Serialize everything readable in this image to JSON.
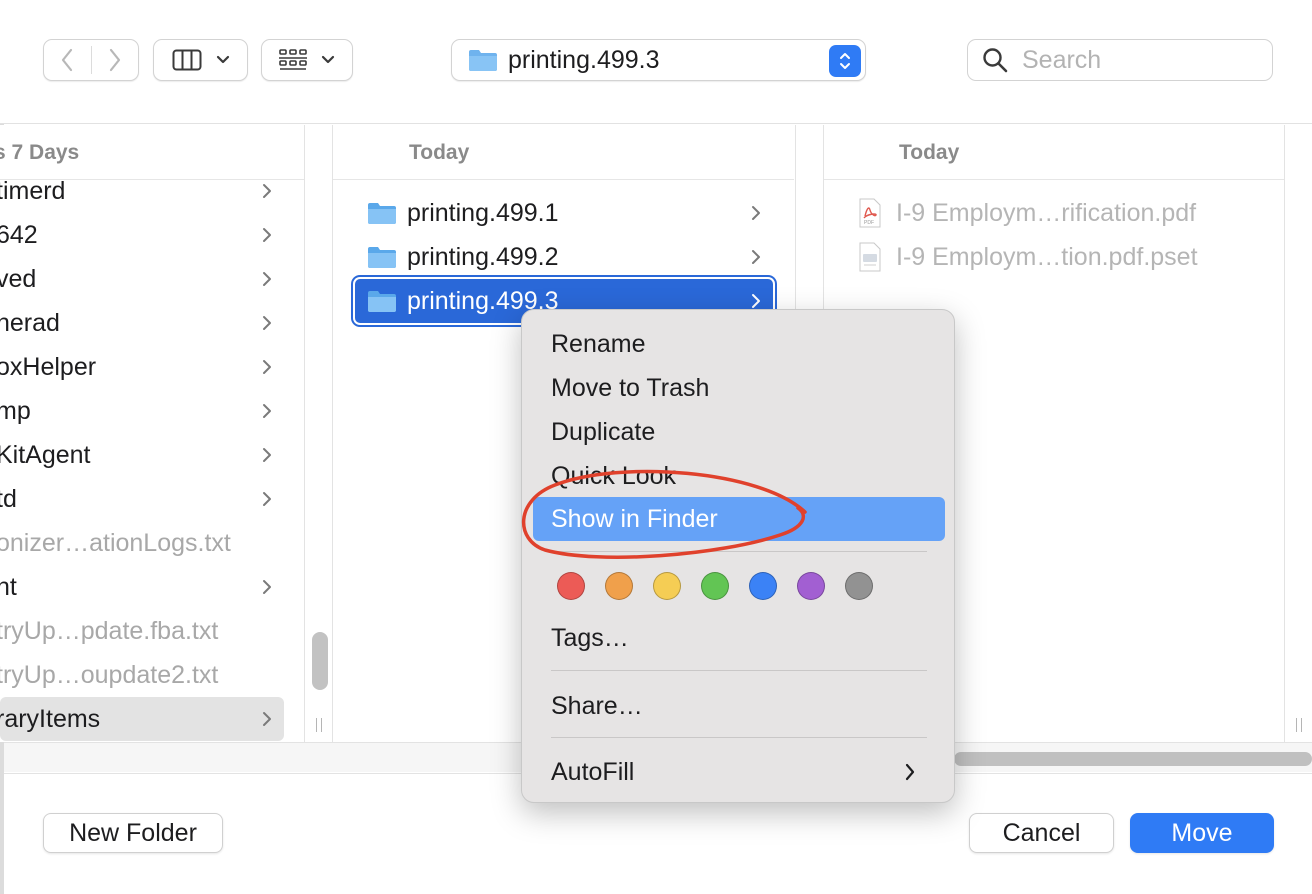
{
  "toolbar": {
    "path_label": "printing.499.3",
    "search_placeholder": "Search"
  },
  "columns": [
    {
      "header": "s 7 Days",
      "items": [
        {
          "label": "timerd",
          "has_children": true,
          "dimmed": false
        },
        {
          "label": "642",
          "has_children": true,
          "dimmed": false
        },
        {
          "label": "ved",
          "has_children": true,
          "dimmed": false
        },
        {
          "label": "nerad",
          "has_children": true,
          "dimmed": false
        },
        {
          "label": "oxHelper",
          "has_children": true,
          "dimmed": false
        },
        {
          "label": "mp",
          "has_children": true,
          "dimmed": false
        },
        {
          "label": "KitAgent",
          "has_children": true,
          "dimmed": false
        },
        {
          "label": "td",
          "has_children": true,
          "dimmed": false
        },
        {
          "label": "onizer…ationLogs.txt",
          "has_children": false,
          "dimmed": true
        },
        {
          "label": "nt",
          "has_children": true,
          "dimmed": false
        },
        {
          "label": "tryUp…pdate.fba.txt",
          "has_children": false,
          "dimmed": true
        },
        {
          "label": "tryUp…oupdate2.txt",
          "has_children": false,
          "dimmed": true
        },
        {
          "label": "raryItems",
          "has_children": true,
          "dimmed": false,
          "selected": true
        }
      ]
    },
    {
      "header": "Today",
      "items": [
        {
          "label": "printing.499.1",
          "icon": "folder-icon"
        },
        {
          "label": "printing.499.2",
          "icon": "folder-icon"
        },
        {
          "label": "printing.499.3",
          "icon": "folder-icon",
          "selected": true
        }
      ]
    },
    {
      "header": "Today",
      "items": [
        {
          "label": "I-9 Employm…rification.pdf",
          "icon": "pdf-file-icon"
        },
        {
          "label": "I-9 Employm…tion.pdf.pset",
          "icon": "document-file-icon"
        }
      ]
    }
  ],
  "context_menu": {
    "items": {
      "rename": "Rename",
      "move_to_trash": "Move to Trash",
      "duplicate": "Duplicate",
      "quick_look": "Quick Look",
      "show_in_finder": "Show in Finder",
      "tags": "Tags…",
      "share": "Share…",
      "autofill": "AutoFill"
    },
    "highlighted": "Show in Finder",
    "tag_colors": [
      "#ec5b56",
      "#f0a04b",
      "#f5cd54",
      "#62c554",
      "#3b82f6",
      "#a25fd2",
      "#929292"
    ]
  },
  "buttons": {
    "new_folder": "New Folder",
    "cancel": "Cancel",
    "move": "Move"
  },
  "colors": {
    "accent": "#2f7bf5",
    "selection": "#2a68d8",
    "menu_highlight": "#65a2f7",
    "annotation": "#e0412c"
  }
}
